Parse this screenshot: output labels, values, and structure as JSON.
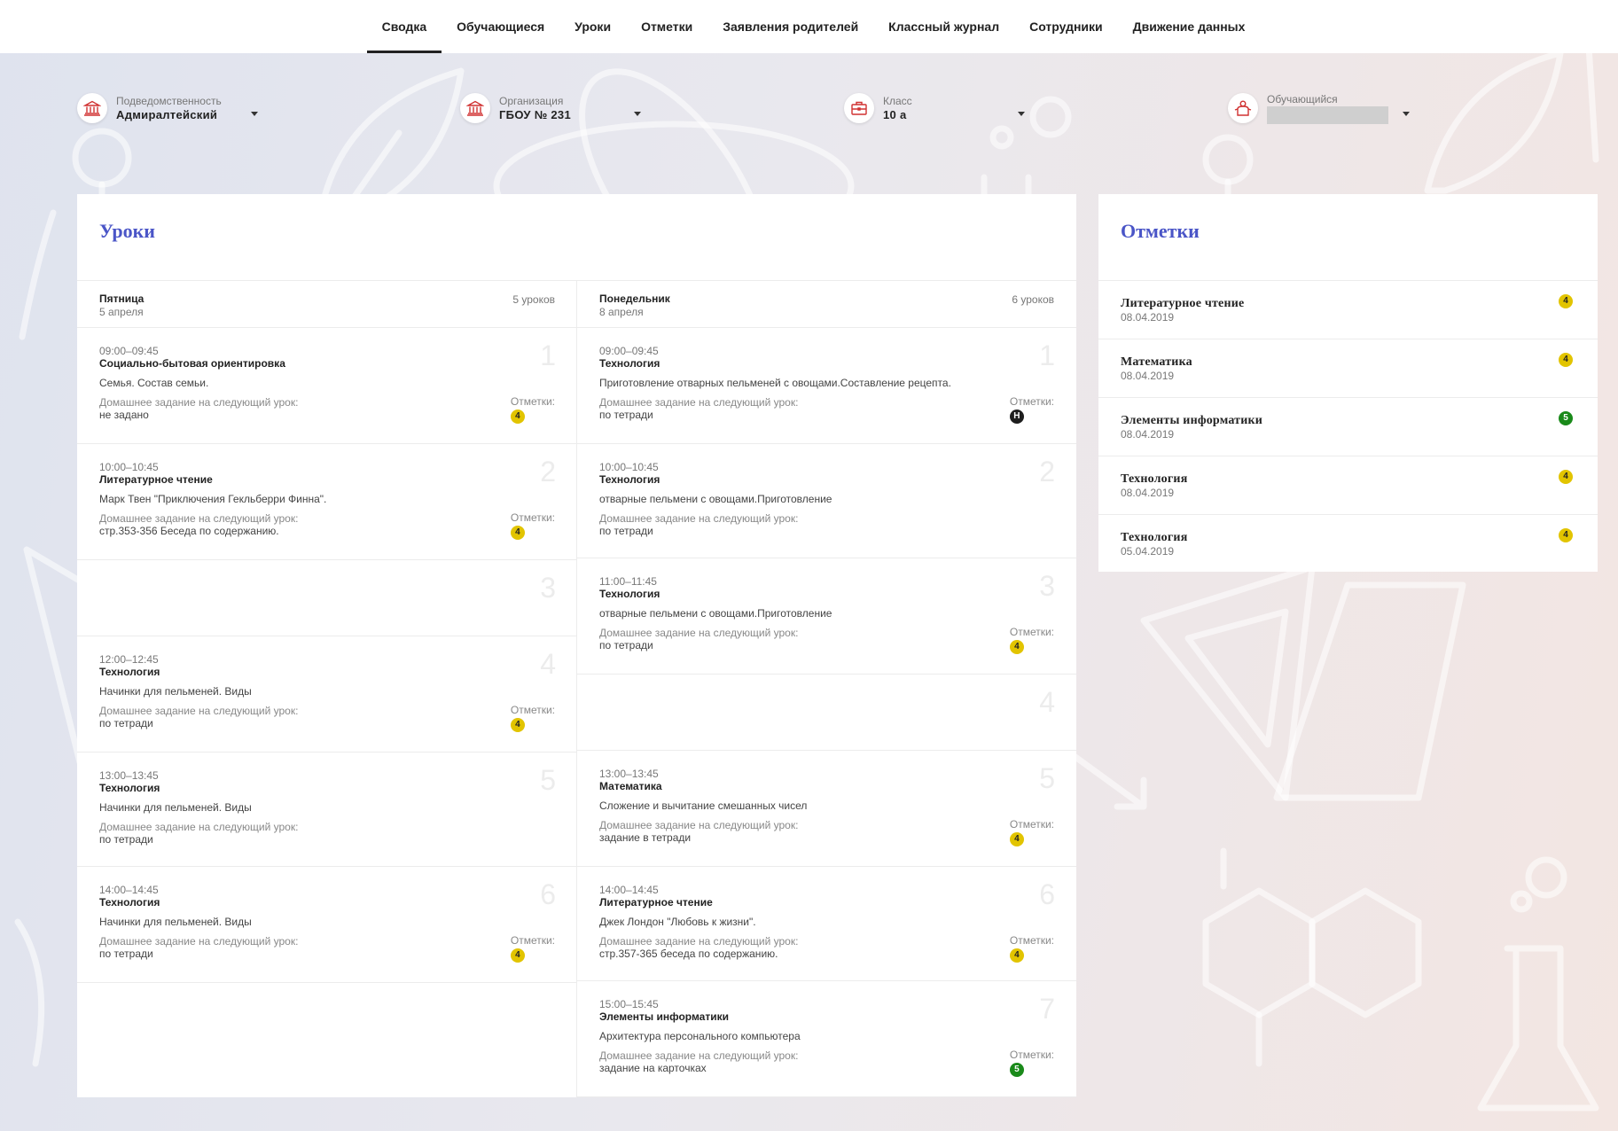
{
  "colors": {
    "accent": "#4a55c7",
    "badge_4": "#e2c400",
    "badge_5": "#1a8a1a",
    "badge_n": "#1e1e1e",
    "icon_red": "#d03030"
  },
  "nav": {
    "tabs": [
      {
        "label": "Сводка",
        "active": true
      },
      {
        "label": "Обучающиеся"
      },
      {
        "label": "Уроки"
      },
      {
        "label": "Отметки"
      },
      {
        "label": "Заявления родителей"
      },
      {
        "label": "Классный журнал"
      },
      {
        "label": "Сотрудники"
      },
      {
        "label": "Движение данных"
      }
    ]
  },
  "filters": {
    "subordination": {
      "label": "Подведомственность",
      "value": "Адмиралтейский",
      "icon": "institution-icon"
    },
    "organization": {
      "label": "Организация",
      "value": "ГБОУ № 231",
      "icon": "institution-icon"
    },
    "class": {
      "label": "Класс",
      "value": "10 а",
      "icon": "briefcase-icon"
    },
    "student": {
      "label": "Обучающийся",
      "value": "",
      "icon": "student-icon"
    }
  },
  "lessons": {
    "title": "Уроки",
    "marks_label": "Отметки:",
    "hw_label": "Домашнее задание на следующий урок:",
    "days": [
      {
        "name": "Пятница",
        "date": "5 апреля",
        "count": "5 уроков",
        "lessons": [
          {
            "num": "1",
            "time": "09:00–09:45",
            "subject": "Социально-бытовая ориентировка",
            "topic": "Семья. Состав семьи.",
            "hw": "не задано",
            "mark": "4"
          },
          {
            "num": "2",
            "time": "10:00–10:45",
            "subject": "Литературное чтение",
            "topic": "Марк Твен \"Приключения Гекльберри Финна\".",
            "hw": "стр.353-356 Беседа по содержанию.",
            "mark": "4"
          },
          {
            "num": "3",
            "empty": true
          },
          {
            "num": "4",
            "time": "12:00–12:45",
            "subject": "Технология",
            "topic": "Начинки для пельменей. Виды",
            "hw": "по тетради",
            "mark": "4"
          },
          {
            "num": "5",
            "time": "13:00–13:45",
            "subject": "Технология",
            "topic": "Начинки для пельменей. Виды",
            "hw": "по тетради",
            "mark": ""
          },
          {
            "num": "6",
            "time": "14:00–14:45",
            "subject": "Технология",
            "topic": "Начинки для пельменей. Виды",
            "hw": "по тетради",
            "mark": "4"
          }
        ]
      },
      {
        "name": "Понедельник",
        "date": "8 апреля",
        "count": "6 уроков",
        "lessons": [
          {
            "num": "1",
            "time": "09:00–09:45",
            "subject": "Технология",
            "topic": "Приготовление отварных пельменей с овощами.Составление рецепта.",
            "hw": "по тетради",
            "mark": "Н"
          },
          {
            "num": "2",
            "time": "10:00–10:45",
            "subject": "Технология",
            "topic": "отварные пельмени с овощами.Приготовление",
            "hw": "по тетради",
            "mark": ""
          },
          {
            "num": "3",
            "time": "11:00–11:45",
            "subject": "Технология",
            "topic": "отварные пельмени с овощами.Приготовление",
            "hw": "по тетради",
            "mark": "4"
          },
          {
            "num": "4",
            "empty": true
          },
          {
            "num": "5",
            "time": "13:00–13:45",
            "subject": "Математика",
            "topic": "Сложение и вычитание смешанных чисел",
            "hw": "задание в тетради",
            "mark": "4"
          },
          {
            "num": "6",
            "time": "14:00–14:45",
            "subject": "Литературное чтение",
            "topic": "Джек Лондон \"Любовь к жизни\".",
            "hw": "стр.357-365 беседа по содержанию.",
            "mark": "4"
          },
          {
            "num": "7",
            "time": "15:00–15:45",
            "subject": "Элементы информатики",
            "topic": "Архитектура персонального компьютера",
            "hw": "задание на карточках",
            "mark": "5"
          }
        ]
      }
    ]
  },
  "marks": {
    "title": "Отметки",
    "items": [
      {
        "subject": "Литературное чтение",
        "date": "08.04.2019",
        "mark": "4"
      },
      {
        "subject": "Математика",
        "date": "08.04.2019",
        "mark": "4"
      },
      {
        "subject": "Элементы информатики",
        "date": "08.04.2019",
        "mark": "5"
      },
      {
        "subject": "Технология",
        "date": "08.04.2019",
        "mark": "4"
      },
      {
        "subject": "Технология",
        "date": "05.04.2019",
        "mark": "4"
      }
    ]
  }
}
